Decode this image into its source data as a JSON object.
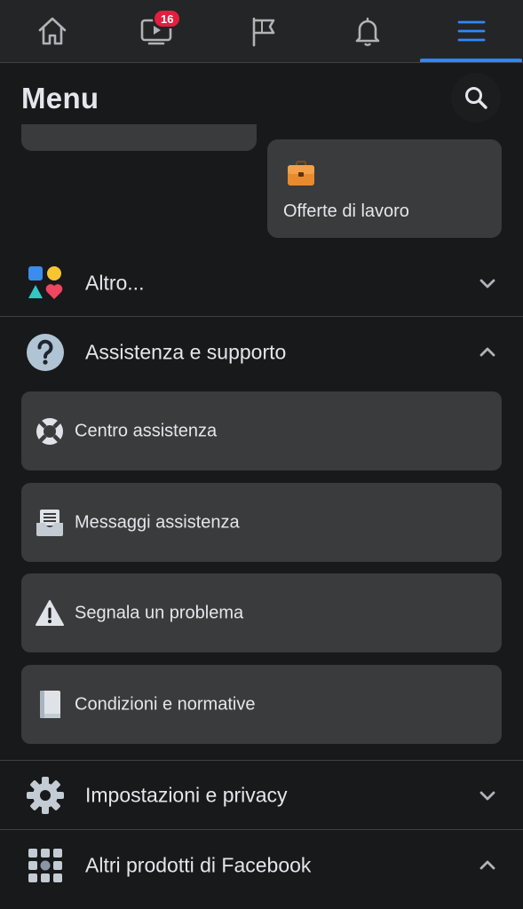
{
  "nav": {
    "items": [
      {
        "name": "home-icon"
      },
      {
        "name": "watch-icon"
      },
      {
        "name": "pages-flag-icon"
      },
      {
        "name": "notifications-bell-icon"
      },
      {
        "name": "menu-hamburger-icon"
      }
    ],
    "watch_badge": "16",
    "active_color": "#2d88ff",
    "badge_color": "#e41e3f"
  },
  "header": {
    "title": "Menu",
    "search_icon": "search-icon"
  },
  "shortcuts": {
    "jobs_label": "Offerte di lavoro",
    "jobs_icon": "briefcase-icon"
  },
  "sections": {
    "more": {
      "label": "Altro...",
      "icon": "shapes-icon",
      "expanded": false
    },
    "help": {
      "label": "Assistenza e supporto",
      "icon": "question-circle-icon",
      "expanded": true,
      "items": [
        {
          "label": "Centro assistenza",
          "icon": "lifebuoy-icon"
        },
        {
          "label": "Messaggi assistenza",
          "icon": "inbox-icon"
        },
        {
          "label": "Segnala un problema",
          "icon": "warning-icon"
        },
        {
          "label": "Condizioni e normative",
          "icon": "book-icon"
        }
      ]
    },
    "settings": {
      "label": "Impostazioni e privacy",
      "icon": "gear-icon",
      "expanded": false
    },
    "products": {
      "label": "Altri prodotti di Facebook",
      "icon": "grid-icon",
      "expanded": true
    }
  }
}
